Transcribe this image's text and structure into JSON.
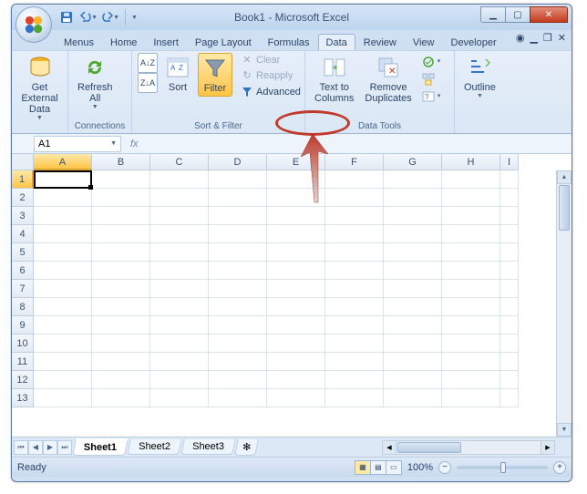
{
  "window": {
    "title": "Book1 - Microsoft Excel"
  },
  "qat": {
    "save": "Save",
    "undo": "Undo",
    "redo": "Redo"
  },
  "tabs": {
    "items": [
      "Menus",
      "Home",
      "Insert",
      "Page Layout",
      "Formulas",
      "Data",
      "Review",
      "View",
      "Developer"
    ],
    "active": "Data"
  },
  "ribbon": {
    "get_external": {
      "label": "Get External\nData",
      "group": ""
    },
    "connections": {
      "refresh": "Refresh\nAll",
      "group": "Connections"
    },
    "sort_filter": {
      "sort_az": "A→Z",
      "sort_za": "Z→A",
      "sort": "Sort",
      "filter": "Filter",
      "clear": "Clear",
      "reapply": "Reapply",
      "advanced": "Advanced",
      "group": "Sort & Filter"
    },
    "data_tools": {
      "text_to_columns": "Text to\nColumns",
      "remove_dups": "Remove\nDuplicates",
      "group": "Data Tools"
    },
    "outline": {
      "label": "Outline",
      "group": ""
    }
  },
  "formula_bar": {
    "name_box": "A1",
    "fx": "fx",
    "value": ""
  },
  "columns": [
    "A",
    "B",
    "C",
    "D",
    "E",
    "F",
    "G",
    "H",
    "I"
  ],
  "rows": [
    1,
    2,
    3,
    4,
    5,
    6,
    7,
    8,
    9,
    10,
    11,
    12,
    13
  ],
  "active_cell": "A1",
  "sheets": {
    "items": [
      "Sheet1",
      "Sheet2",
      "Sheet3"
    ],
    "active": "Sheet1"
  },
  "status": {
    "left": "Ready",
    "zoom": "100%"
  }
}
